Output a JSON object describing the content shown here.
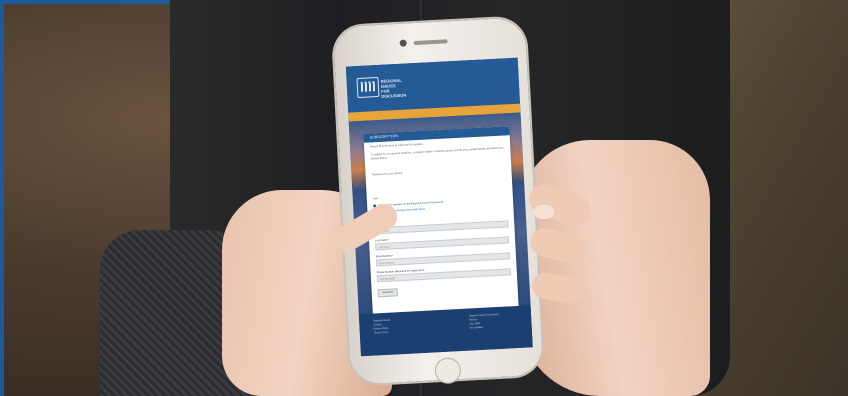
{
  "scene": {
    "description_label": "Hands holding smartphone showing a mobile web form"
  },
  "phone": {
    "header": {
      "logo_text_lines": [
        "REGIONAL",
        "ISSUES",
        "FOR DISCUSSION"
      ]
    },
    "form": {
      "title": "SUBSCRIPTION",
      "intro_1": "Please fill in the form to subscribe for updates.",
      "intro_2": "To register for our general email list, or receive notices of events, please provide your contact details and select your interest below.",
      "intro_3": "Thank you for your interest.",
      "radio_group_label": "I am:",
      "radio_options": [
        {
          "label": "Interested in updates on the Regional Issues Framework",
          "selected": true
        },
        {
          "label": "Interested in receiving event notifications",
          "selected": false
        }
      ],
      "fields": [
        {
          "label": "First Name*",
          "placeholder": "First Name"
        },
        {
          "label": "Last Name*",
          "placeholder": "Last Name"
        },
        {
          "label": "Email Address*",
          "placeholder": "Email Address"
        },
        {
          "label": "Phone Number (Required for registration)",
          "placeholder": "555-555-5555"
        }
      ],
      "submit_label": "Subscribe"
    },
    "footer": {
      "left_lines": [
        "Regional Issues",
        "Contact",
        "Privacy Policy",
        "Terms of Use"
      ],
      "right_lines": [
        "Regional Issues Framework",
        "PO Box",
        "City, State",
        "Get Updates"
      ]
    }
  },
  "colors": {
    "frame": "#1d5a9a",
    "header": "#245a96",
    "accent": "#e7a43a"
  }
}
